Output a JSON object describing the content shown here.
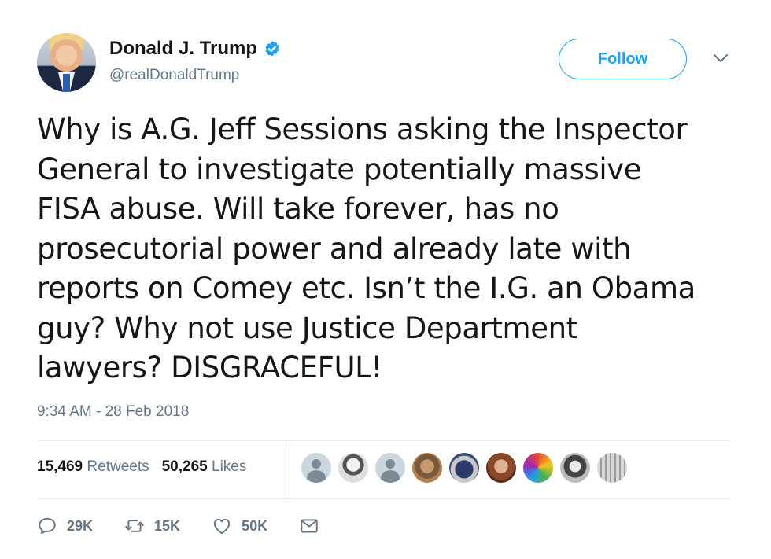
{
  "user": {
    "name": "Donald J. Trump",
    "handle": "@realDonaldTrump",
    "verified": true
  },
  "header": {
    "follow_label": "Follow"
  },
  "tweet": {
    "lines": [
      "Why is A.G. Jeff Sessions asking the Inspector",
      "General to investigate potentially massive",
      "FISA abuse. Will take forever, has no",
      "prosecutorial power and already late with",
      "reports on Comey etc. Isn’t the I.G. an Obama",
      "guy? Why not use Justice Department",
      "lawyers? DISGRACEFUL!"
    ],
    "timestamp": "9:34 AM - 28 Feb 2018"
  },
  "stats": {
    "retweets_count": "15,469",
    "retweets_label": "Retweets",
    "likes_count": "50,265",
    "likes_label": "Likes"
  },
  "likers": [
    {
      "icon": "default-avatar-icon"
    },
    {
      "icon": "person-avatar-icon"
    },
    {
      "icon": "default-avatar-icon"
    },
    {
      "icon": "person-avatar-icon"
    },
    {
      "icon": "person-avatar-icon"
    },
    {
      "icon": "person-avatar-icon"
    },
    {
      "icon": "person-avatar-icon"
    },
    {
      "icon": "person-avatar-icon"
    },
    {
      "icon": "logo-avatar-icon"
    }
  ],
  "actions": {
    "reply_count": "29K",
    "retweet_count": "15K",
    "like_count": "50K"
  },
  "colors": {
    "accent": "#1da1f2",
    "secondary_text": "#657786",
    "text": "#14171a",
    "divider": "#e6ecf0"
  }
}
